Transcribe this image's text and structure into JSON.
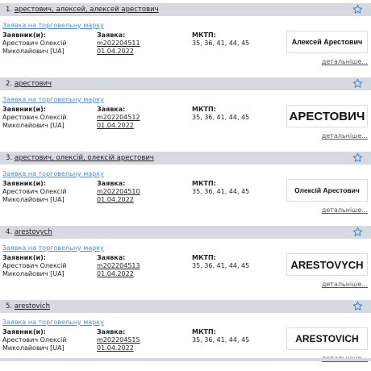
{
  "results": [
    {
      "index": "1.",
      "name": "арестович, алексей, алексей арестович",
      "type_link": "Заявка на торговельну марку",
      "applicant_label": "Заявник(и):",
      "applicant_line1": "Арестович Олексій",
      "applicant_line2": "Миколайович [UA]",
      "application_label": "Заявка:",
      "application_number": "m202204511",
      "application_date": "01.04.2022",
      "classes_label": "МКТП:",
      "classes": "35, 36, 41, 44, 45",
      "mark_text": "Алексей Арестович",
      "more_label": "детальніше..."
    },
    {
      "index": "2.",
      "name": "арестович",
      "type_link": "Заявка на торговельну марку",
      "applicant_label": "Заявник(и):",
      "applicant_line1": "Арестович Олексій",
      "applicant_line2": "Миколайович [UA]",
      "application_label": "Заявка:",
      "application_number": "m202204512",
      "application_date": "01.04.2022",
      "classes_label": "МКТП:",
      "classes": "35, 36, 41, 44, 45",
      "mark_text": "АРЕСТОВИЧ",
      "more_label": "детальніше..."
    },
    {
      "index": "3.",
      "name": "арестович, олексій, олексій арестович",
      "type_link": "Заявка на торговельну марку",
      "applicant_label": "Заявник(и):",
      "applicant_line1": "Арестович Олексій",
      "applicant_line2": "Миколайович [UA]",
      "application_label": "Заявка:",
      "application_number": "m202204510",
      "application_date": "01.04.2022",
      "classes_label": "МКТП:",
      "classes": "35, 36, 41, 44, 45",
      "mark_text": "Олексій Арестович",
      "more_label": "детальніше..."
    },
    {
      "index": "4.",
      "name": "arestovych",
      "type_link": "Заявка на торговельну марку",
      "applicant_label": "Заявник(и):",
      "applicant_line1": "Арестович Олексій",
      "applicant_line2": "Миколайович [UA]",
      "application_label": "Заявка:",
      "application_number": "m202204513",
      "application_date": "01.04.2022",
      "classes_label": "МКТП:",
      "classes": "35, 36, 41, 44, 45",
      "mark_text": "ARESTOVYCH",
      "more_label": "детальніше..."
    },
    {
      "index": "5.",
      "name": "arestovich",
      "type_link": "Заявка на торговельну марку",
      "applicant_label": "Заявник(и):",
      "applicant_line1": "Арестович Олексій",
      "applicant_line2": "Миколайович [UA]",
      "application_label": "Заявка:",
      "application_number": "m202204515",
      "application_date": "01.04.2022",
      "classes_label": "МКТП:",
      "classes": "35, 36, 41, 44, 45",
      "mark_text": "ARESTOVICH",
      "more_label": "детальніше..."
    }
  ],
  "icons": {
    "favorite": "star-outline-icon"
  },
  "colors": {
    "header_bg": "#d6d9de",
    "link": "#4a8fd0",
    "star": "#3a7fd0"
  }
}
